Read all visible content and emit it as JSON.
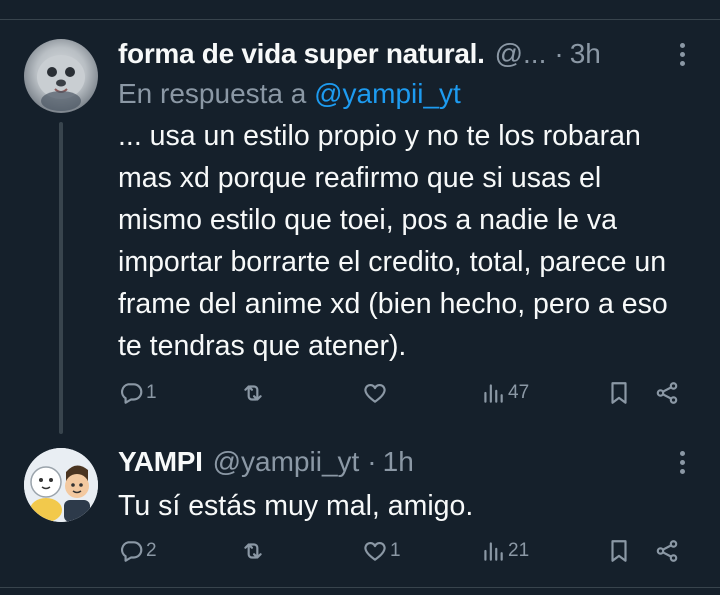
{
  "tweets": [
    {
      "author_name": "forma de vida super natural.",
      "handle": "@...",
      "separator": "·",
      "time": "3h",
      "reply_prefix": "En respuesta a",
      "reply_mention": "@yampii_yt",
      "text": "... usa un estilo propio y no te los robaran mas xd porque reafirmo que si usas el mismo estilo que toei, pos a nadie le va importar borrarte el credito, total, parece un frame del anime xd (bien hecho, pero a eso te tendras que atener).",
      "replies": "1",
      "retweets": "",
      "likes": "",
      "views": "47"
    },
    {
      "author_name": "YAMPI",
      "handle": "@yampii_yt",
      "separator": "·",
      "time": "1h",
      "text": "Tu sí estás muy mal, amigo.",
      "replies": "2",
      "retweets": "",
      "likes": "1",
      "views": "21"
    }
  ],
  "icons": {
    "reply": "reply-icon",
    "retweet": "retweet-icon",
    "like": "heart-icon",
    "views": "views-icon",
    "bookmark": "bookmark-icon",
    "share": "share-icon",
    "more": "more-icon"
  },
  "colors": {
    "background": "#15202b",
    "text": "#f7f9f9",
    "secondary": "#8b98a5",
    "mention": "#1d9bf0",
    "divider": "#38444d"
  }
}
